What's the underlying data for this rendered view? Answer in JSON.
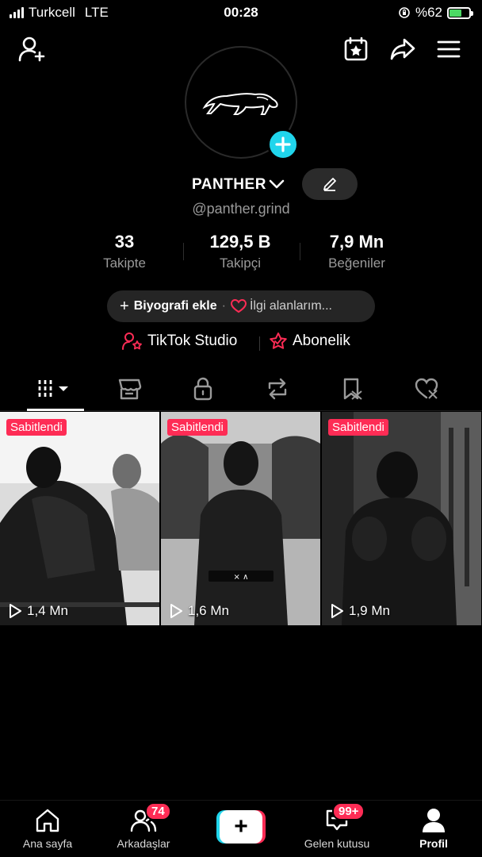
{
  "status_bar": {
    "carrier": "Turkcell",
    "network": "LTE",
    "time": "00:28",
    "battery": "%62",
    "battery_level": 0.62,
    "battery_color": "#4cd964"
  },
  "profile": {
    "display_name": "PANTHER",
    "handle": "@panther.grind",
    "avatar_icon": "panther-logo-icon",
    "add_icon": "plus-icon"
  },
  "stats": [
    {
      "value": "33",
      "label": "Takipte"
    },
    {
      "value": "129,5 B",
      "label": "Takipçi"
    },
    {
      "value": "7,9 Mn",
      "label": "Beğeniler"
    }
  ],
  "bio": {
    "add_label": "Biyografi ekle",
    "separator": "·",
    "interests_label": "İlgi alanlarım..."
  },
  "links": {
    "studio_label": "TikTok Studio",
    "subscription_label": "Abonelik"
  },
  "tabs": [
    {
      "icon": "videos-grid-icon",
      "active": true
    },
    {
      "icon": "shop-icon"
    },
    {
      "icon": "lock-icon"
    },
    {
      "icon": "repost-icon"
    },
    {
      "icon": "favorites-icon"
    },
    {
      "icon": "liked-icon"
    }
  ],
  "videos": [
    {
      "pinned_label": "Sabitlendi",
      "views": "1,4 Mn"
    },
    {
      "pinned_label": "Sabitlendi",
      "views": "1,6 Mn"
    },
    {
      "pinned_label": "Sabitlendi",
      "views": "1,9 Mn"
    }
  ],
  "bottom_nav": [
    {
      "label": "Ana sayfa",
      "icon": "home-icon"
    },
    {
      "label": "Arkadaşlar",
      "icon": "friends-icon",
      "badge": "74"
    },
    {
      "label": "",
      "icon": "create-icon"
    },
    {
      "label": "Gelen kutusu",
      "icon": "inbox-icon",
      "badge": "99+"
    },
    {
      "label": "Profil",
      "icon": "profile-icon",
      "active": true
    }
  ],
  "colors": {
    "accent_red": "#fe2c55",
    "accent_cyan": "#20d5ec",
    "background": "#000000"
  }
}
